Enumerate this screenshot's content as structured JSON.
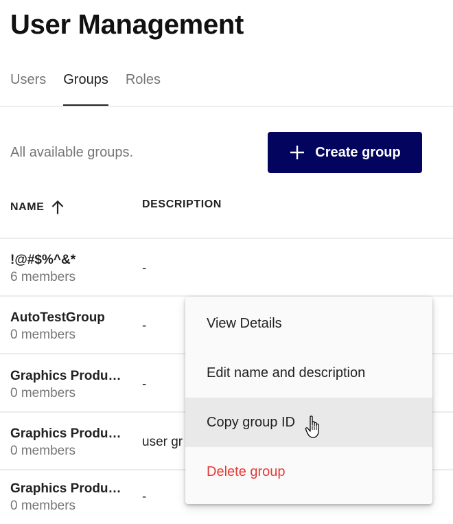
{
  "page": {
    "title": "User Management"
  },
  "tabs": [
    {
      "label": "Users",
      "active": false
    },
    {
      "label": "Groups",
      "active": true
    },
    {
      "label": "Roles",
      "active": false
    }
  ],
  "groups_panel": {
    "subtitle": "All available groups.",
    "create_button": {
      "label": "Create group",
      "icon": "plus-icon"
    }
  },
  "table": {
    "columns": [
      {
        "label": "NAME",
        "sort": "ascending",
        "icon": "arrow-up-icon"
      },
      {
        "label": "DESCRIPTION"
      }
    ],
    "rows": [
      {
        "name": "!@#$%^&*",
        "members": "6 members",
        "description": "-"
      },
      {
        "name": "AutoTestGroup",
        "members": "0 members",
        "description": "-"
      },
      {
        "name": "Graphics Produ…",
        "members": "0 members",
        "description": "-"
      },
      {
        "name": "Graphics Produ…",
        "members": "0 members",
        "description": "user gr"
      },
      {
        "name": "Graphics Produ…",
        "members": "0 members",
        "description": "-"
      }
    ]
  },
  "context_menu": {
    "items": [
      {
        "label": "View Details"
      },
      {
        "label": "Edit name and description"
      },
      {
        "label": "Copy group ID",
        "state": "hovered"
      },
      {
        "label": "Delete group",
        "variant": "danger"
      }
    ]
  },
  "colors": {
    "primary_button": "#03045e",
    "danger_text": "#e53935",
    "muted_text": "#757575",
    "menu_hover": "#e9e9e9"
  },
  "cursor": {
    "icon": "hand-pointer-icon"
  }
}
